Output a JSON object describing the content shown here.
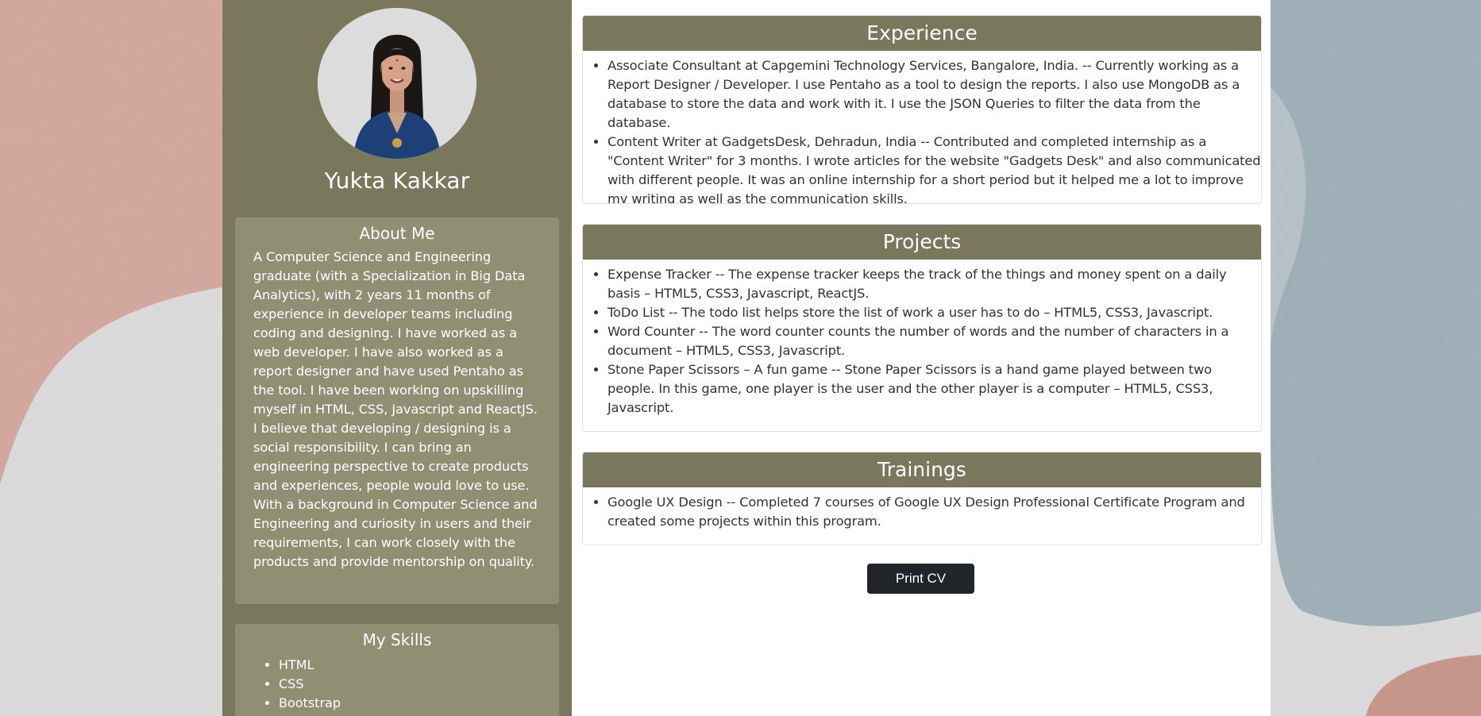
{
  "colors": {
    "sidebar": "#79785c",
    "card": "#8f8f73",
    "header": "#79785c",
    "button": "#212529",
    "background_pink": "#d6a9a0",
    "background_blue": "#9fb1bb"
  },
  "profile": {
    "name": "Yukta Kakkar",
    "photo_icon": "profile-photo"
  },
  "about": {
    "title": "About Me",
    "text": "A Computer Science and Engineering graduate (with a Specialization in Big Data Analytics), with 2 years 11 months of experience in developer teams including coding and designing. I have worked as a web developer. I have also worked as a report designer and have used Pentaho as the tool. I have been working on upskilling myself in HTML, CSS, Javascript and ReactJS. I believe that developing / designing is a social responsibility. I can bring an engineering perspective to create products and experiences, people would love to use. With a background in Computer Science and Engineering and curiosity in users and their requirements, I can work closely with the products and provide mentorship on quality."
  },
  "skills": {
    "title": "My Skills",
    "items": [
      "HTML",
      "CSS",
      "Bootstrap"
    ]
  },
  "experience": {
    "title": "Experience",
    "items": [
      "Associate Consultant at Capgemini Technology Services, Bangalore, India. -- Currently working as a Report Designer / Developer. I use Pentaho as a tool to design the reports. I also use MongoDB as a database to store the data and work with it. I use the JSON Queries to filter the data from the database.",
      "Content Writer at GadgetsDesk, Dehradun, India -- Contributed and completed internship as a \"Content Writer\" for 3 months. I wrote articles for the website \"Gadgets Desk\" and also communicated with different people. It was an online internship for a short period but it helped me a lot to improve my writing as well as the communication skills."
    ]
  },
  "projects": {
    "title": "Projects",
    "items": [
      "Expense Tracker -- The expense tracker keeps the track of the things and money spent on a daily basis – HTML5, CSS3, Javascript, ReactJS.",
      "ToDo List -- The todo list helps store the list of work a user has to do – HTML5, CSS3, Javascript.",
      "Word Counter -- The word counter counts the number of words and the number of characters in a document – HTML5, CSS3, Javascript.",
      "Stone Paper Scissors – A fun game -- Stone Paper Scissors is a hand game played between two people. In this game, one player is the user and the other player is a computer – HTML5, CSS3, Javascript."
    ]
  },
  "trainings": {
    "title": "Trainings",
    "items": [
      "Google UX Design -- Completed 7 courses of Google UX Design Professional Certificate Program and created some projects within this program."
    ]
  },
  "print_button": {
    "label": "Print CV"
  }
}
